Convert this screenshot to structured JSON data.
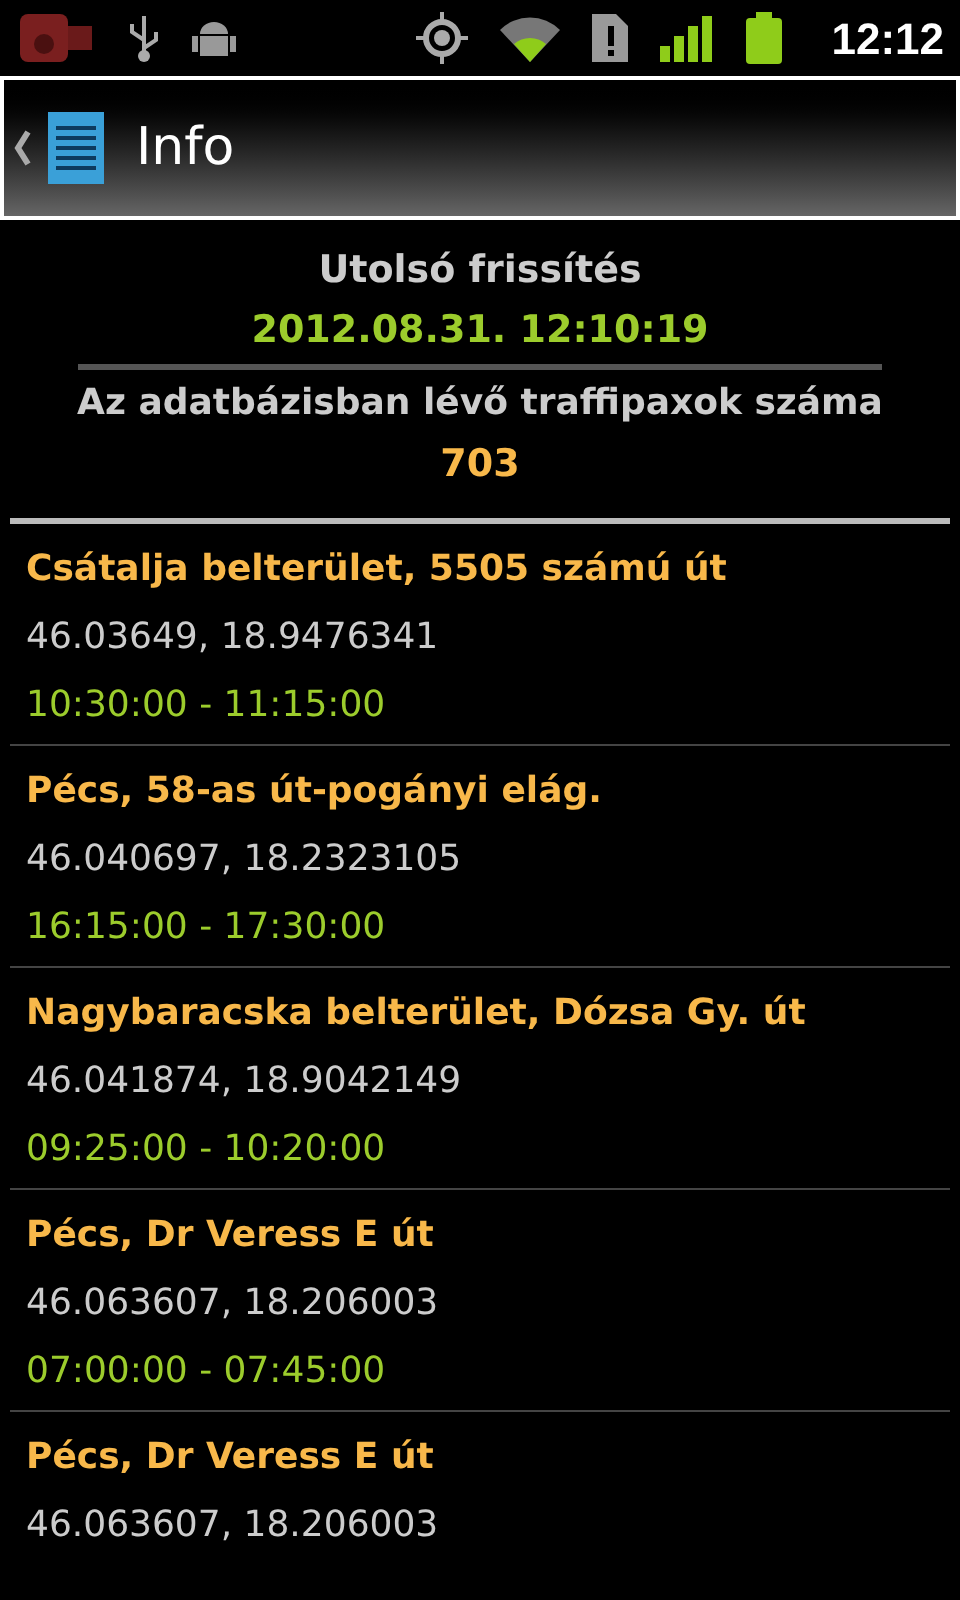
{
  "status_bar": {
    "time": "12:12"
  },
  "title_bar": {
    "title": "Info"
  },
  "summary": {
    "update_label": "Utolsó frissítés",
    "update_value": "2012.08.31. 12:10:19",
    "count_label": "Az adatbázisban lévő traffipaxok száma",
    "count_value": "703"
  },
  "cameras": [
    {
      "place": "Csátalja belterület, 5505 számú út",
      "coords": "46.03649, 18.9476341",
      "time": "10:30:00 - 11:15:00"
    },
    {
      "place": "Pécs, 58-as út-pogányi elág.",
      "coords": "46.040697, 18.2323105",
      "time": "16:15:00 - 17:30:00"
    },
    {
      "place": "Nagybaracska belterület, Dózsa Gy. út",
      "coords": "46.041874, 18.9042149",
      "time": "09:25:00 - 10:20:00"
    },
    {
      "place": "Pécs, Dr Veress E út",
      "coords": "46.063607, 18.206003",
      "time": "07:00:00 - 07:45:00"
    },
    {
      "place": "Pécs, Dr Veress E út",
      "coords": "46.063607, 18.206003"
    }
  ]
}
